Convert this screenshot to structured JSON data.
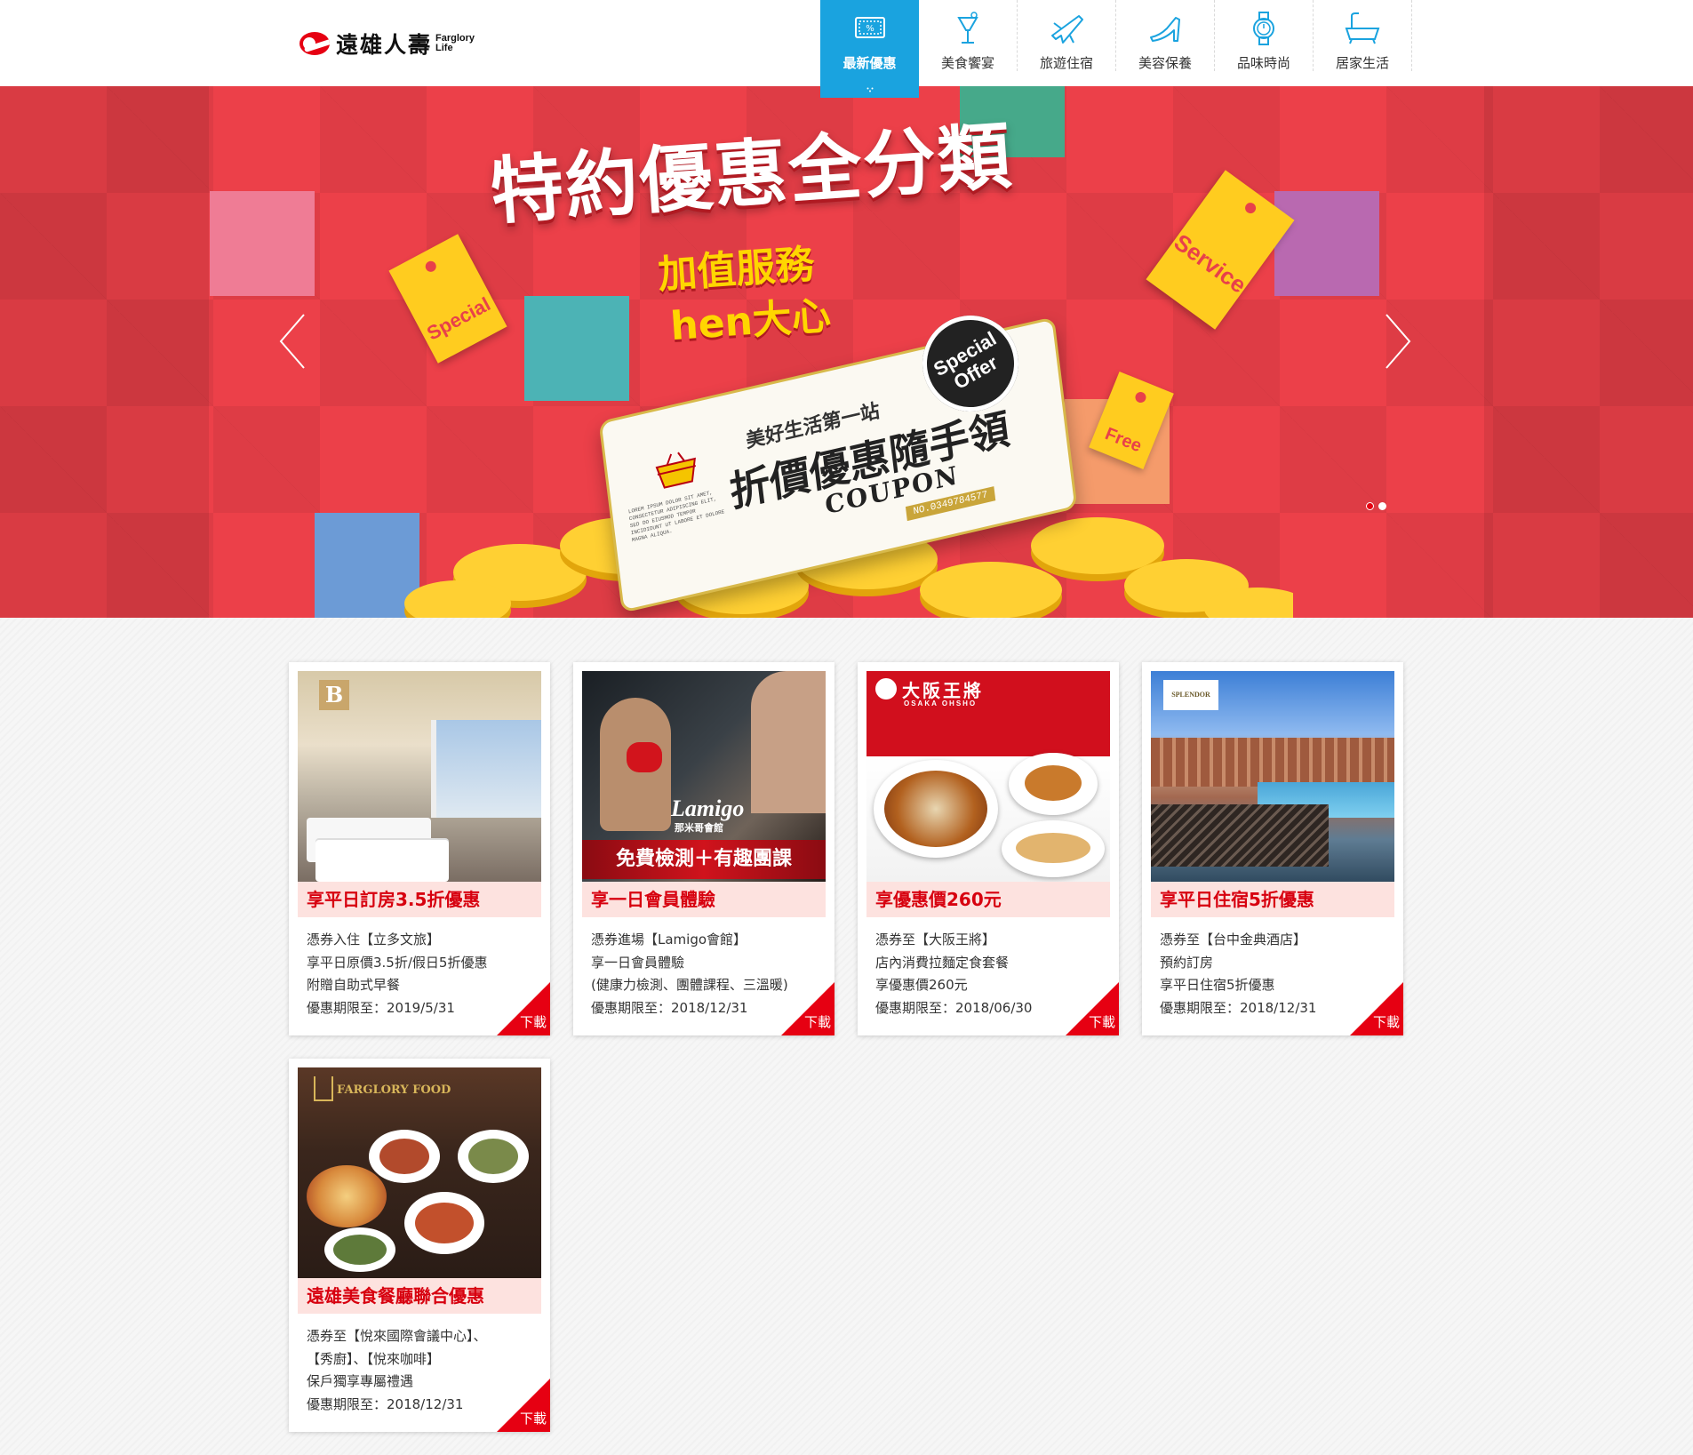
{
  "header": {
    "logo": {
      "cn": "遠雄人壽",
      "en_line1": "Farglory",
      "en_line2": "Life"
    },
    "nav": [
      {
        "label": "最新優惠",
        "icon": "coupon-icon",
        "active": true
      },
      {
        "label": "美食饗宴",
        "icon": "cocktail-icon",
        "active": false
      },
      {
        "label": "旅遊住宿",
        "icon": "airplane-icon",
        "active": false
      },
      {
        "label": "美容保養",
        "icon": "high-heel-icon",
        "active": false
      },
      {
        "label": "品味時尚",
        "icon": "watch-icon",
        "active": false
      },
      {
        "label": "居家生活",
        "icon": "bathtub-icon",
        "active": false
      }
    ],
    "accent": "#1aa3df"
  },
  "banner": {
    "title": "特約優惠全分類",
    "sub1": "加值服務",
    "sub2": "hen大心",
    "tags": [
      "Special",
      "Service",
      "Free"
    ],
    "seal": "Special Offer",
    "coupon": {
      "line1": "美好生活第一站",
      "line2": "折價優惠隨手領",
      "line3": "COUPON",
      "number": "NO.0349784577",
      "lorem": "LOREM IPSUM DOLOR SIT AMET, CONSECTETUR ADIPISCING ELIT, SED DO EIUSMOD TEMPOR INCIDIDUNT UT LABORE ET DOLORE MAGNA ALIQUA."
    },
    "slides": 2,
    "current_slide": 1,
    "background": "#ec4049"
  },
  "cards": [
    {
      "headline": "享平日訂房3.5折優惠",
      "image_caption": "",
      "lines": [
        "憑券入住【立多文旅】",
        "享平日原價3.5折/假日5折優惠",
        "附贈自助式早餐",
        "優惠期限至：2019/5/31"
      ],
      "download": "下載"
    },
    {
      "headline": "享一日會員體驗",
      "image_caption": "免費檢測＋有趣團課",
      "image_brand": "Lamigo",
      "image_brand_sub": "那米哥會館",
      "lines": [
        "憑券進場【Lamigo會館】",
        "享一日會員體驗",
        "(健康力檢測、團體課程、三溫暖)",
        "優惠期限至：2018/12/31"
      ],
      "download": "下載"
    },
    {
      "headline": "享優惠價260元",
      "image_brand": "大阪王將",
      "image_brand_sub": "OSAKA OHSHO",
      "lines": [
        "憑券至【大阪王將】",
        "店內消費拉麵定食套餐",
        "享優惠價260元",
        "優惠期限至：2018/06/30"
      ],
      "download": "下載"
    },
    {
      "headline": "享平日住宿5折優惠",
      "image_brand": "SPLENDOR",
      "lines": [
        "憑券至【台中金典酒店】",
        "預約訂房",
        "享平日住宿5折優惠",
        "優惠期限至：2018/12/31"
      ],
      "download": "下載"
    },
    {
      "headline": "遠雄美食餐廳聯合優惠",
      "image_brand": "FARGLORY FOOD",
      "lines": [
        "憑券至【悅來國際會議中心】、",
        "【秀廚】、【悅來咖啡】",
        "保戶獨享專屬禮遇",
        "優惠期限至：2018/12/31"
      ],
      "download": "下載"
    }
  ],
  "colors": {
    "brand_red": "#e60012",
    "headline_bg": "#fde2df",
    "headline_text": "#d7000f"
  }
}
